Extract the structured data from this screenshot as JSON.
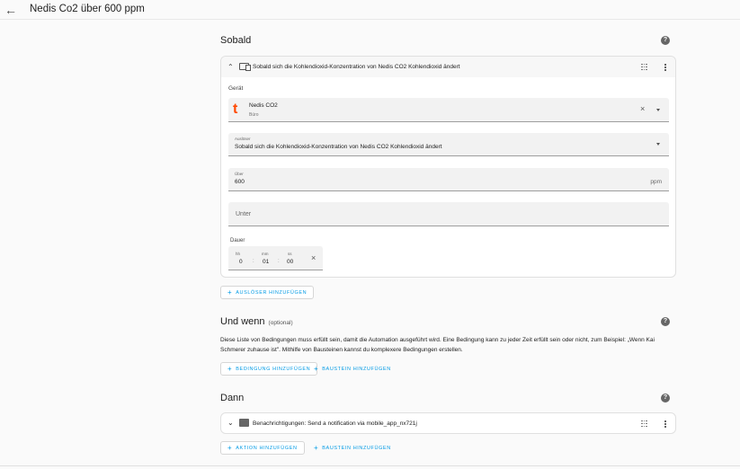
{
  "header": {
    "title": "Nedis Co2 über 600 ppm"
  },
  "sobald": {
    "heading": "Sobald",
    "trigger": {
      "title": "Sobald sich die Kohlendioxid-Konzentration von Nedis CO2 Kohlendioxid ändert",
      "geraet_label": "Gerät",
      "device_name": "Nedis CO2",
      "device_area": "Büro",
      "ausloeser_label": "Auslöser",
      "ausloeser_value": "Sobald sich die Kohlendioxid-Konzentration von Nedis CO2 Kohlendioxid ändert",
      "ueber_label": "Über",
      "ueber_value": "600",
      "ueber_unit": "ppm",
      "unter_label": "Unter",
      "dauer_label": "Dauer",
      "dauer": {
        "hh_label": "hh",
        "hh": "0",
        "mm_label": "mm",
        "mm": "01",
        "ss_label": "ss",
        "ss": "00"
      }
    },
    "add_trigger": "AUSLÖSER HINZUFÜGEN"
  },
  "und_wenn": {
    "heading": "Und wenn",
    "optional": "(optional)",
    "description": "Diese Liste von Bedingungen muss erfüllt sein, damit die Automation ausgeführt wird. Eine Bedingung kann zu jeder Zeit erfüllt sein oder nicht, zum Beispiel: „Wenn Kai Schmerer zuhause ist\". Mithilfe von Bausteinen kannst du komplexere Bedingungen erstellen.",
    "add_condition": "BEDINGUNG HINZUFÜGEN",
    "add_block": "BAUSTEIN HINZUFÜGEN"
  },
  "dann": {
    "heading": "Dann",
    "action_title": "Benachrichtigungen: Send a notification via mobile_app_nx721j",
    "add_action": "AKTION HINZUFÜGEN",
    "add_block": "BAUSTEIN HINZUFÜGEN"
  },
  "colors": {
    "accent": "#039be5",
    "brand_tuya": "#ff4800"
  }
}
